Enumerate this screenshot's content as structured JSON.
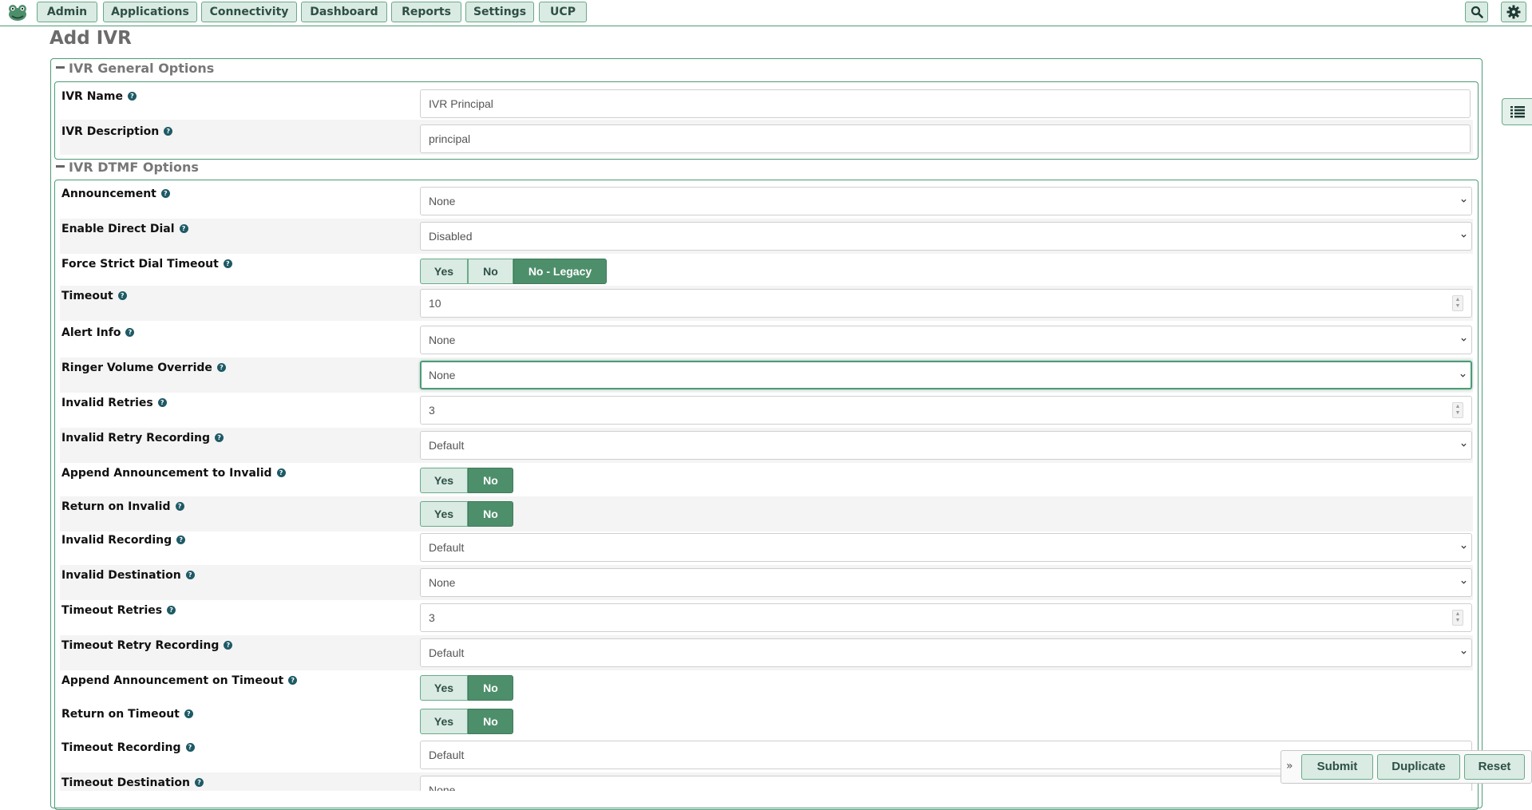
{
  "nav": {
    "items": [
      "Admin",
      "Applications",
      "Connectivity",
      "Dashboard",
      "Reports",
      "Settings",
      "UCP"
    ],
    "search_icon": "search-icon",
    "settings_icon": "gear-icon"
  },
  "page": {
    "title": "Add IVR"
  },
  "general": {
    "legend": "IVR General Options",
    "name_label": "IVR Name",
    "name_value": "IVR Principal",
    "description_label": "IVR Description",
    "description_value": "principal"
  },
  "dtmf": {
    "legend": "IVR DTMF Options",
    "fields": {
      "announcement": {
        "label": "Announcement",
        "value": "None"
      },
      "direct_dial": {
        "label": "Enable Direct Dial",
        "value": "Disabled"
      },
      "strict_timeout": {
        "label": "Force Strict Dial Timeout",
        "options": [
          "Yes",
          "No",
          "No - Legacy"
        ],
        "selected": "No - Legacy"
      },
      "timeout": {
        "label": "Timeout",
        "value": "10"
      },
      "alert_info": {
        "label": "Alert Info",
        "value": "None"
      },
      "ringer_volume": {
        "label": "Ringer Volume Override",
        "value": "None"
      },
      "invalid_retries": {
        "label": "Invalid Retries",
        "value": "3"
      },
      "invalid_retry_recording": {
        "label": "Invalid Retry Recording",
        "value": "Default"
      },
      "append_invalid": {
        "label": "Append Announcement to Invalid",
        "options": [
          "Yes",
          "No"
        ],
        "selected": "No"
      },
      "return_invalid": {
        "label": "Return on Invalid",
        "options": [
          "Yes",
          "No"
        ],
        "selected": "No"
      },
      "invalid_recording": {
        "label": "Invalid Recording",
        "value": "Default"
      },
      "invalid_destination": {
        "label": "Invalid Destination",
        "value": "None"
      },
      "timeout_retries": {
        "label": "Timeout Retries",
        "value": "3"
      },
      "timeout_retry_recording": {
        "label": "Timeout Retry Recording",
        "value": "Default"
      },
      "append_timeout": {
        "label": "Append Announcement on Timeout",
        "options": [
          "Yes",
          "No"
        ],
        "selected": "No"
      },
      "return_timeout": {
        "label": "Return on Timeout",
        "options": [
          "Yes",
          "No"
        ],
        "selected": "No"
      },
      "timeout_recording": {
        "label": "Timeout Recording",
        "value": "Default"
      },
      "timeout_destination": {
        "label": "Timeout Destination",
        "value": "None"
      }
    }
  },
  "actions": {
    "submit": "Submit",
    "duplicate": "Duplicate",
    "reset": "Reset"
  },
  "icons": {
    "help": "help-icon",
    "side_tab": "list-icon",
    "expand": "double-chevron-right-icon"
  },
  "colors": {
    "accent": "#4d9b77",
    "button_bg": "#d9ebe3",
    "toggle_on": "#4e8f6b"
  }
}
